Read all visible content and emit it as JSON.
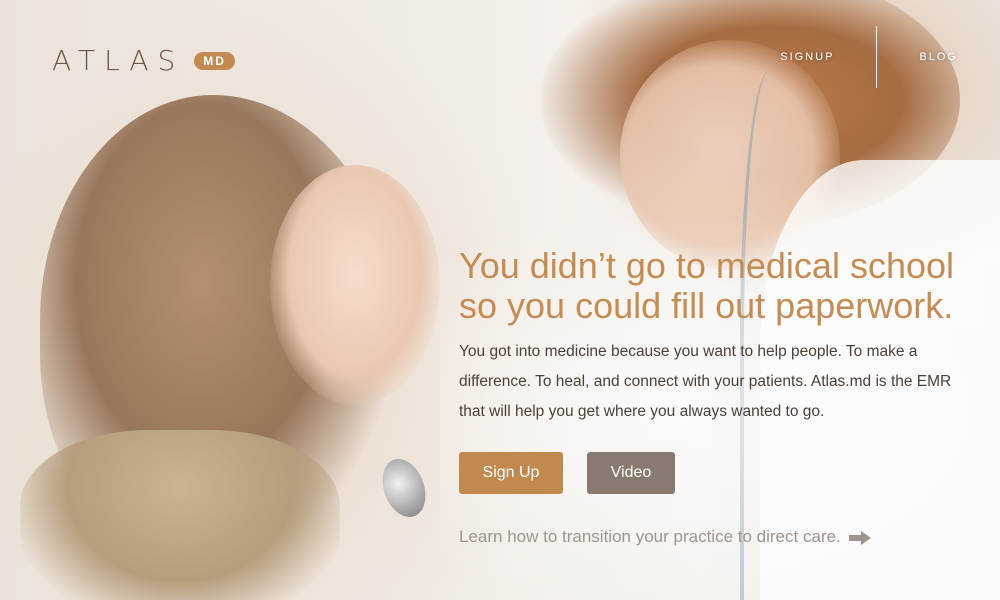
{
  "brand": {
    "wordmark": "ATLAS",
    "badge": "MD"
  },
  "nav": {
    "items": [
      {
        "label": "SIGNUP"
      },
      {
        "label": "BLOG"
      }
    ]
  },
  "hero": {
    "headline": "You didn’t go to medical school so you could fill out paperwork.",
    "body": "You got into medicine because you want to help people. To make a difference. To heal, and connect with your patients. Atlas.md is the EMR that will help you get where you always wanted to go.",
    "signup_label": "Sign Up",
    "video_label": "Video",
    "transition_link": "Learn how to transition your practice to direct care.",
    "link_icon": "arrow-right-icon"
  },
  "colors": {
    "accent": "#c1894e",
    "secondary_button": "#887a70",
    "headline": "#c48c55",
    "logo": "#6f5646"
  }
}
